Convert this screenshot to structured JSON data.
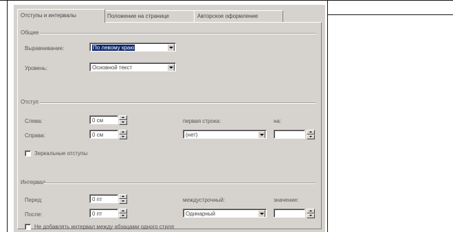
{
  "tabs": [
    "Отступы и интервалы",
    "Положение на странице",
    "Авторское оформление"
  ],
  "general": {
    "title": "Общие",
    "alignment_label": "Выравнивание:",
    "alignment_value": "По левому краю",
    "level_label": "Уровень:",
    "level_value": "Основной текст"
  },
  "indent": {
    "title": "Отступ",
    "left_label": "Слева:",
    "left_value": "0 см",
    "right_label": "Справа:",
    "right_value": "0 см",
    "first_line_label": "первая строка:",
    "first_line_value": "(нет)",
    "by_label": "на:",
    "by_value": "",
    "mirror_label": "Зеркальные отступы"
  },
  "spacing": {
    "title": "Интервал",
    "before_label": "Перед:",
    "before_value": "0 пт",
    "after_label": "После:",
    "after_value": "0 пт",
    "line_label": "междустрочный:",
    "line_value": "Одинарный",
    "value_label": "значение:",
    "value_value": "",
    "no_space_label": "Не добавлять интервал между абзацами одного стиля"
  }
}
